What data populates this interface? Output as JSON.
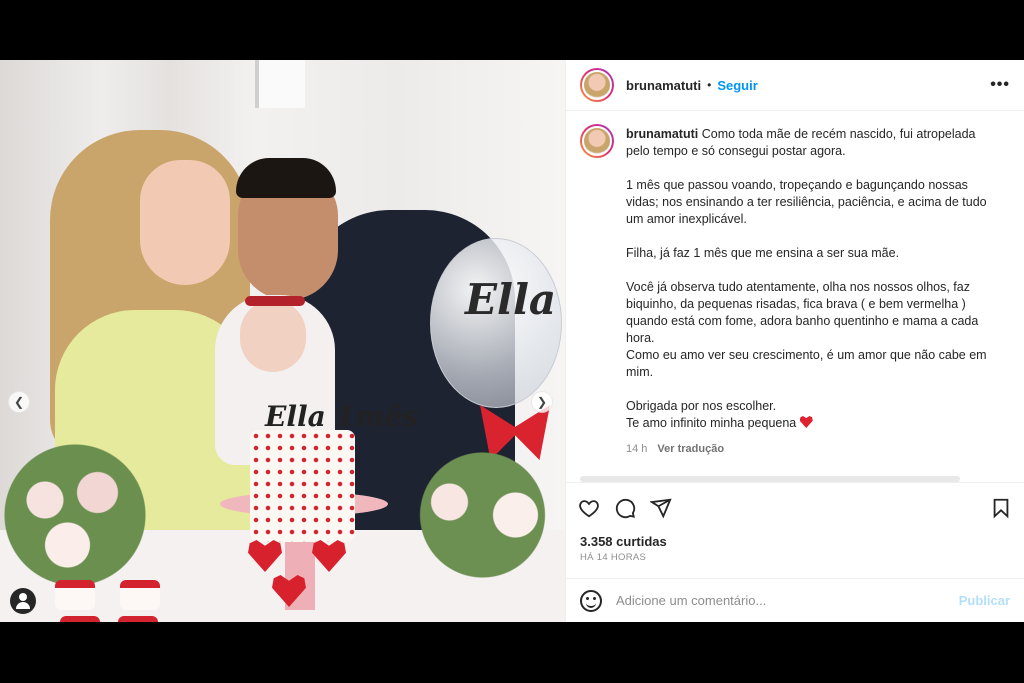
{
  "post": {
    "username": "brunamatuti",
    "follow_label": "Seguir",
    "separator": "•",
    "more_label": "•••"
  },
  "photo": {
    "cake_topper": "Ella 1mês",
    "balloon_text": "Ella"
  },
  "caption": {
    "username": "brunamatuti",
    "paragraphs": [
      "Como toda mãe de recém nascido, fui atropelada pelo tempo e só consegui postar agora.",
      "1 mês que passou voando, tropeçando e bagunçando nossas vidas; nos ensinando a ter resiliência, paciência, e acima de tudo um amor inexplicável.",
      "Filha, já faz 1 mês que me ensina a ser sua mãe.",
      "Você já observa tudo atentamente, olha nos nossos olhos, faz biquinho, da pequenas risadas, fica brava ( e bem vermelha ) quando está com fome, adora banho quentinho e mama a cada hora.\nComo eu amo ver seu crescimento, é um amor que não cabe em mim.",
      "Obrigada por nos escolher.\nTe amo infinito minha pequena"
    ],
    "time_ago": "14 h",
    "translate_label": "Ver tradução"
  },
  "stats": {
    "likes": "3.358 curtidas",
    "posted": "HÁ 14 HORAS"
  },
  "comment_box": {
    "placeholder": "Adicione um comentário...",
    "publish_label": "Publicar"
  },
  "colors": {
    "accent": "#0095f6",
    "publish_disabled": "#b2dffc",
    "heart": "#e0212f"
  },
  "icons": [
    "chevron-left-icon",
    "chevron-right-icon",
    "user-tag-icon",
    "more-icon",
    "heart-icon",
    "comment-icon",
    "share-icon",
    "bookmark-icon",
    "emoji-icon"
  ]
}
